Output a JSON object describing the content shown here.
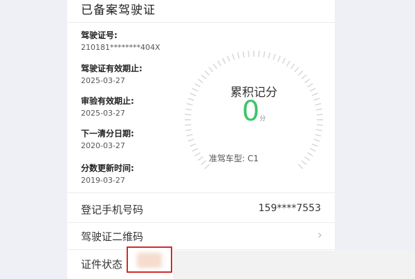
{
  "card": {
    "title": "已备案驾驶证"
  },
  "license": {
    "number_label": "驾驶证号:",
    "number_value": "210181********404X",
    "valid_until_label": "驾驶证有效期止:",
    "valid_until_value": "2025-03-27",
    "review_until_label": "审验有效期止:",
    "review_until_value": "2025-03-27",
    "next_clear_label": "下一清分日期:",
    "next_clear_value": "2020-03-27",
    "score_update_label": "分数更新时间:",
    "score_update_value": "2019-03-27"
  },
  "score": {
    "title": "累积记分",
    "value": "0",
    "unit": "分",
    "car_type": "准驾车型:  C1",
    "accent_color": "#3cc56a"
  },
  "rows": {
    "phone_label": "登记手机号码",
    "phone_value": "159****7553",
    "qr_label": "驾驶证二维码",
    "status_label": "证件状态"
  }
}
